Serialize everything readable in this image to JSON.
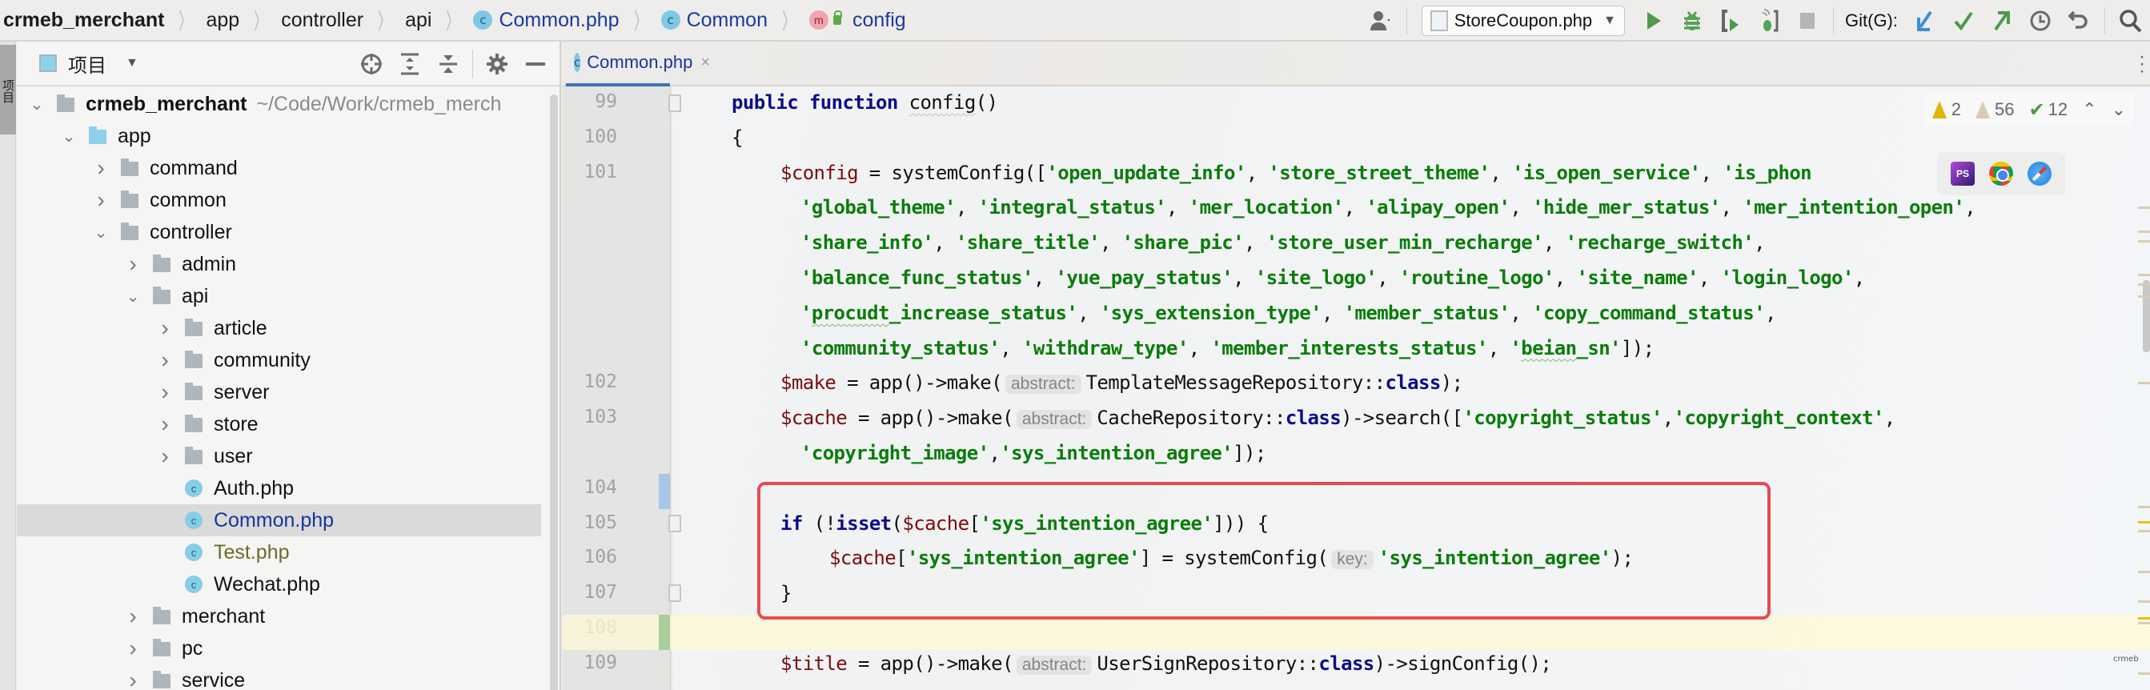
{
  "breadcrumbs": [
    {
      "label": "crmeb_merchant",
      "icon": null,
      "style": "bold"
    },
    {
      "label": "app",
      "icon": null,
      "style": "normal"
    },
    {
      "label": "controller",
      "icon": null,
      "style": "normal"
    },
    {
      "label": "api",
      "icon": null,
      "style": "normal"
    },
    {
      "label": "Common.php",
      "icon": "class-icon",
      "style": "blue"
    },
    {
      "label": "Common",
      "icon": "class-icon",
      "style": "blue"
    },
    {
      "label": "config",
      "icon": "method-icon",
      "style": "blue"
    }
  ],
  "icons": {
    "class_glyph": "c",
    "method_glyph": "m"
  },
  "toolbar": {
    "run_config": "StoreCoupon.php",
    "git_label": "Git(G):"
  },
  "toolstrip": {
    "label": "项目"
  },
  "sidebar": {
    "title": "项目",
    "tree": [
      {
        "label": "crmeb_merchant",
        "path": "~/Code/Work/crmeb_merch",
        "depth": 0,
        "type": "folder",
        "expanded": true,
        "bold": true
      },
      {
        "label": "app",
        "depth": 1,
        "type": "folder-blue",
        "expanded": true
      },
      {
        "label": "command",
        "depth": 2,
        "type": "folder",
        "expanded": false
      },
      {
        "label": "common",
        "depth": 2,
        "type": "folder",
        "expanded": false
      },
      {
        "label": "controller",
        "depth": 2,
        "type": "folder",
        "expanded": true
      },
      {
        "label": "admin",
        "depth": 3,
        "type": "folder",
        "expanded": false
      },
      {
        "label": "api",
        "depth": 3,
        "type": "folder",
        "expanded": true
      },
      {
        "label": "article",
        "depth": 4,
        "type": "folder",
        "expanded": false
      },
      {
        "label": "community",
        "depth": 4,
        "type": "folder",
        "expanded": false
      },
      {
        "label": "server",
        "depth": 4,
        "type": "folder",
        "expanded": false
      },
      {
        "label": "store",
        "depth": 4,
        "type": "folder",
        "expanded": false
      },
      {
        "label": "user",
        "depth": 4,
        "type": "folder",
        "expanded": false
      },
      {
        "label": "Auth.php",
        "depth": 4,
        "type": "class"
      },
      {
        "label": "Common.php",
        "depth": 4,
        "type": "class",
        "selected": true,
        "color": "blue"
      },
      {
        "label": "Test.php",
        "depth": 4,
        "type": "class",
        "color": "olive"
      },
      {
        "label": "Wechat.php",
        "depth": 4,
        "type": "class"
      },
      {
        "label": "merchant",
        "depth": 3,
        "type": "folder",
        "expanded": false
      },
      {
        "label": "pc",
        "depth": 3,
        "type": "folder",
        "expanded": false
      },
      {
        "label": "service",
        "depth": 3,
        "type": "folder",
        "expanded": false
      }
    ]
  },
  "editor": {
    "tab": {
      "label": "Common.php",
      "close": "×"
    },
    "inspections": {
      "errors": "2",
      "warnings": "56",
      "typos": "12"
    },
    "line_numbers": [
      "99",
      "100",
      "101",
      "",
      "",
      "",
      "",
      "",
      "102",
      "103",
      "",
      "104",
      "105",
      "106",
      "107",
      "108",
      "109"
    ],
    "lines": [
      {
        "indent": 0,
        "tokens": [
          [
            "kw",
            "public "
          ],
          [
            "kw",
            "function "
          ],
          [
            "fn",
            "config"
          ],
          [
            "p",
            "()"
          ]
        ]
      },
      {
        "indent": 0,
        "tokens": [
          [
            "p",
            "{"
          ]
        ]
      },
      {
        "indent": 1,
        "tokens": [
          [
            "var",
            "$config"
          ],
          [
            "p",
            " = systemConfig(["
          ],
          [
            "str",
            "'open_update_info'"
          ],
          [
            "p",
            ", "
          ],
          [
            "str",
            "'store_street_theme'"
          ],
          [
            "p",
            ", "
          ],
          [
            "str",
            "'is_open_service'"
          ],
          [
            "p",
            ", "
          ],
          [
            "str",
            "'is_phon"
          ]
        ]
      },
      {
        "indent": 2,
        "tokens": [
          [
            "str",
            "'global_theme'"
          ],
          [
            "p",
            ", "
          ],
          [
            "str",
            "'integral_status'"
          ],
          [
            "p",
            ", "
          ],
          [
            "str",
            "'mer_location'"
          ],
          [
            "p",
            ", "
          ],
          [
            "str",
            "'alipay_open'"
          ],
          [
            "p",
            ", "
          ],
          [
            "str",
            "'hide_mer_status'"
          ],
          [
            "p",
            ", "
          ],
          [
            "str",
            "'mer_intention_open'"
          ],
          [
            "p",
            ","
          ]
        ]
      },
      {
        "indent": 2,
        "tokens": [
          [
            "str",
            "'share_info'"
          ],
          [
            "p",
            ", "
          ],
          [
            "str",
            "'share_title'"
          ],
          [
            "p",
            ", "
          ],
          [
            "str",
            "'share_pic'"
          ],
          [
            "p",
            ", "
          ],
          [
            "str",
            "'store_user_min_recharge'"
          ],
          [
            "p",
            ", "
          ],
          [
            "str",
            "'recharge_switch'"
          ],
          [
            "p",
            ","
          ]
        ]
      },
      {
        "indent": 2,
        "tokens": [
          [
            "str",
            "'balance_func_status'"
          ],
          [
            "p",
            ", "
          ],
          [
            "str",
            "'yue_pay_status'"
          ],
          [
            "p",
            ", "
          ],
          [
            "str",
            "'site_logo'"
          ],
          [
            "p",
            ", "
          ],
          [
            "str",
            "'routine_logo'"
          ],
          [
            "p",
            ", "
          ],
          [
            "str",
            "'site_name'"
          ],
          [
            "p",
            ", "
          ],
          [
            "str",
            "'login_logo'"
          ],
          [
            "p",
            ","
          ]
        ]
      },
      {
        "indent": 2,
        "tokens": [
          [
            "str",
            "'"
          ],
          [
            "typo",
            "procudt"
          ],
          [
            "str",
            "_increase_status'"
          ],
          [
            "p",
            ", "
          ],
          [
            "str",
            "'sys_extension_type'"
          ],
          [
            "p",
            ", "
          ],
          [
            "str",
            "'member_status'"
          ],
          [
            "p",
            ", "
          ],
          [
            "str",
            "'copy_command_status'"
          ],
          [
            "p",
            ","
          ]
        ]
      },
      {
        "indent": 2,
        "tokens": [
          [
            "str",
            "'community_status'"
          ],
          [
            "p",
            ", "
          ],
          [
            "str",
            "'withdraw_type'"
          ],
          [
            "p",
            ", "
          ],
          [
            "str",
            "'member_interests_status'"
          ],
          [
            "p",
            ", "
          ],
          [
            "str",
            "'"
          ],
          [
            "typo",
            "beian"
          ],
          [
            "str",
            "_sn'"
          ],
          [
            "p",
            "]);"
          ]
        ]
      },
      {
        "indent": 1,
        "tokens": [
          [
            "var",
            "$make"
          ],
          [
            "p",
            " = app()->make("
          ],
          [
            "hint",
            "abstract:"
          ],
          [
            "p",
            "TemplateMessageRepository::"
          ],
          [
            "kw",
            "class"
          ],
          [
            "p",
            ");"
          ]
        ]
      },
      {
        "indent": 1,
        "tokens": [
          [
            "var",
            "$cache"
          ],
          [
            "p",
            " = app()->make("
          ],
          [
            "hint",
            "abstract:"
          ],
          [
            "p",
            "CacheRepository::"
          ],
          [
            "kw",
            "class"
          ],
          [
            "p",
            ")->search(["
          ],
          [
            "str",
            "'copyright_status'"
          ],
          [
            "p",
            ","
          ],
          [
            "str",
            "'copyright_context'"
          ],
          [
            "p",
            ","
          ]
        ]
      },
      {
        "indent": 2,
        "tokens": [
          [
            "str",
            "'copyright_image'"
          ],
          [
            "p",
            ","
          ],
          [
            "str",
            "'sys_intention_agree'"
          ],
          [
            "p",
            "]);"
          ]
        ]
      },
      {
        "indent": 0,
        "tokens": []
      },
      {
        "indent": 1,
        "tokens": [
          [
            "kw",
            "if "
          ],
          [
            "p",
            "(!"
          ],
          [
            "kw",
            "isset"
          ],
          [
            "p",
            "("
          ],
          [
            "var",
            "$cache"
          ],
          [
            "p",
            "["
          ],
          [
            "str",
            "'sys_intention_agree'"
          ],
          [
            "p",
            "])) {"
          ]
        ]
      },
      {
        "indent": 3,
        "tokens": [
          [
            "var",
            "$cache"
          ],
          [
            "p",
            "["
          ],
          [
            "str",
            "'sys_intention_agree'"
          ],
          [
            "p",
            "] = systemConfig("
          ],
          [
            "hint",
            "key:"
          ],
          [
            "str",
            "'sys_intention_agree'"
          ],
          [
            "p",
            ");"
          ]
        ]
      },
      {
        "indent": 1,
        "tokens": [
          [
            "p",
            "}"
          ]
        ]
      },
      {
        "indent": 0,
        "tokens": []
      },
      {
        "indent": 1,
        "tokens": [
          [
            "var",
            "$title"
          ],
          [
            "p",
            " = app()->make("
          ],
          [
            "hint",
            "abstract:"
          ],
          [
            "p",
            "UserSignRepository::"
          ],
          [
            "kw",
            "class"
          ],
          [
            "p",
            ")->signConfig();"
          ]
        ]
      }
    ]
  },
  "popup": {
    "browsers": [
      "phpstorm-icon",
      "chrome-icon",
      "safari-icon"
    ],
    "ps_label": "PS"
  },
  "watermark": "crmeb"
}
